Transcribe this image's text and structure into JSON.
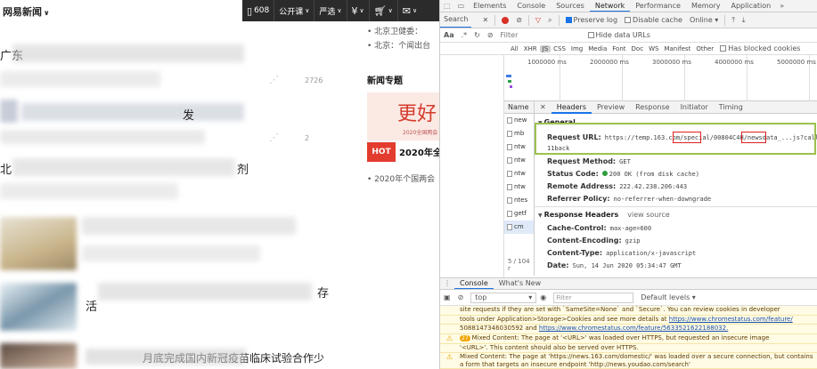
{
  "news": {
    "brand": "网易新闻",
    "nav": [
      {
        "icon": "tablet-icon",
        "label": "608"
      },
      {
        "label": "公开课"
      },
      {
        "label": "严选"
      },
      {
        "icon": "yen-icon",
        "label": ""
      },
      {
        "icon": "cart-icon",
        "label": ""
      },
      {
        "icon": "mail-icon",
        "label": ""
      }
    ],
    "items": [
      {
        "text": "广东"
      },
      {
        "text": "",
        "count": "2726"
      },
      {
        "text": "发"
      },
      {
        "text": "",
        "count": "2"
      },
      {
        "text": "北"
      },
      {
        "text": "剂"
      },
      {
        "text": "活"
      },
      {
        "text": "存"
      },
      {
        "text": "月底完成国内新冠疫苗临床试验合作少16人"
      }
    ],
    "right_links": [
      "北京卫健委：",
      "北京：个闻出台",
      "2020年个国两会"
    ],
    "section_title": "新闻专题",
    "banner_big": "更好",
    "banner_small": "2020全国两会",
    "hot_label": "HOT",
    "hot_text": "2020年全"
  },
  "devtools": {
    "tabs": [
      "Elements",
      "Console",
      "Sources",
      "Network",
      "Performance",
      "Memory",
      "Application"
    ],
    "active_tab": "Network",
    "toolbar": {
      "search_tab": "Search",
      "preserve_log": "Preserve log",
      "disable_cache": "Disable cache",
      "throttle": "Online"
    },
    "filter": {
      "placeholder": "Filter",
      "hide_data_urls": "Hide data URLs"
    },
    "types": [
      "All",
      "XHR",
      "JS",
      "CSS",
      "Img",
      "Media",
      "Font",
      "Doc",
      "WS",
      "Manifest",
      "Other"
    ],
    "has_blocked_cookies": "Has blocked cookies",
    "timeline_ticks": [
      "1000000 ms",
      "2000000 ms",
      "3000000 ms",
      "4000000 ms",
      "5000000 ms"
    ],
    "name_header": "Name",
    "names": [
      "new",
      "mb",
      "ntw",
      "ntw",
      "ntw",
      "ntw",
      "ntes",
      "getf",
      "cm"
    ],
    "summary": "5 / 104 r",
    "detail_tabs": [
      "Headers",
      "Preview",
      "Response",
      "Initiator",
      "Timing"
    ],
    "general": {
      "title": "General",
      "request_url_label": "Request URL:",
      "request_url": "https://temp.163.com/special/00804C4H/newsdata_...js?callback=",
      "request_url_2": "11back",
      "method_label": "Request Method:",
      "method": "GET",
      "status_label": "Status Code:",
      "status": "200 OK (from disk cache)",
      "remote_label": "Remote Address:",
      "remote": "222.42.238.206:443",
      "referrer_label": "Referrer Policy:",
      "referrer": "no-referrer-when-downgrade"
    },
    "response_headers": {
      "title": "Response Headers",
      "view_source": "view source",
      "rows": [
        {
          "k": "Cache-Control:",
          "v": "max-age=600"
        },
        {
          "k": "Content-Encoding:",
          "v": "gzip"
        },
        {
          "k": "Content-Type:",
          "v": "application/x-javascript"
        },
        {
          "k": "Date:",
          "v": "Sun, 14 Jun 2020 05:34:47 GMT"
        }
      ]
    },
    "drawer_tabs": [
      "Console",
      "What's New"
    ],
    "console": {
      "context": "top",
      "filter_placeholder": "Filter",
      "levels": "Default levels",
      "messages": [
        {
          "text": "site requests if they are set with `SameSite=None` and `Secure`. You can review cookies in developer"
        },
        {
          "text": "tools under Application>Storage>Cookies and see more details at ",
          "link": "https://www.chromestatus.com/feature/"
        },
        {
          "text": "5088147346030592 and ",
          "link": "https://www.chromestatus.com/feature/5633521622188032."
        },
        {
          "badge": "27",
          "text": "Mixed Content: The page at '<URL>' was loaded over HTTPS, but requested an insecure image"
        },
        {
          "text": "'<URL>'. This content should also be served over HTTPS."
        },
        {
          "text": "Mixed Content: The page at 'https://news.163.com/domestic/' was loaded over a secure connection, but contains a form that targets an insecure endpoint 'http://news.youdao.com/search'"
        }
      ]
    }
  }
}
